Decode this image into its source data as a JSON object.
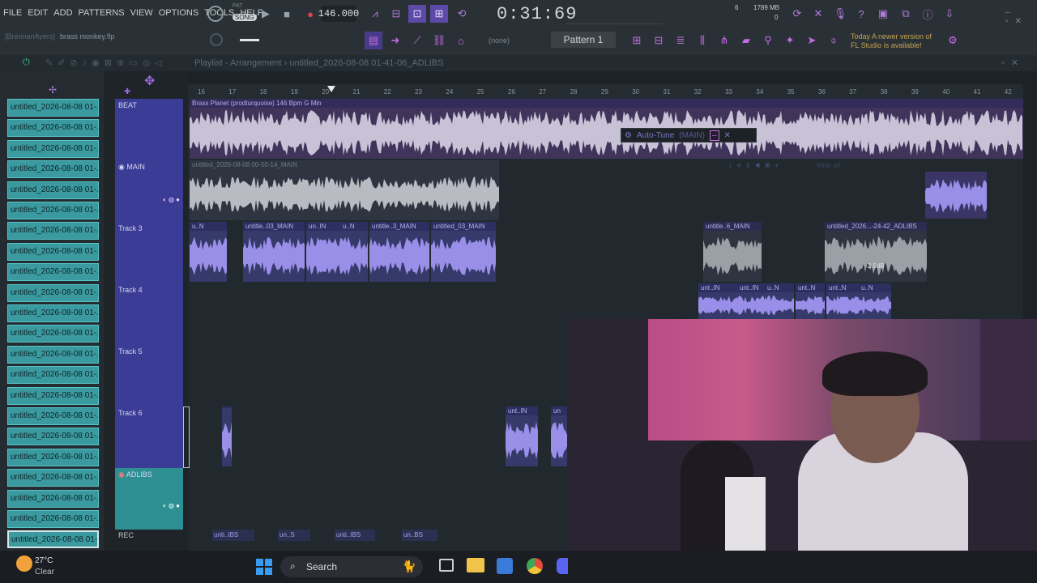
{
  "menu": [
    "FILE",
    "EDIT",
    "ADD",
    "PATTERNS",
    "VIEW",
    "OPTIONS",
    "TOOLS",
    "HELP"
  ],
  "transport": {
    "mode": "SONG",
    "pat_label": "PAT",
    "tempo": "146.000",
    "time": "0:31:69",
    "memory": "1789 MB",
    "cpu": "0",
    "polyphony": "6"
  },
  "project": {
    "hint": "[BrennanAyers]",
    "name": "brass monkey.flp",
    "pattern": "Pattern 1",
    "none": "(none)"
  },
  "news": {
    "line1": "Today  A newer version of",
    "line2": "FL Studio is available!"
  },
  "playlist": {
    "title": "Playlist - Arrangement › untitled_2026-08-08 01-41-06_ADLIBS"
  },
  "pattern_items": [
    "untitled_2026-08-08 01-...",
    "untitled_2026-08-08 01-...",
    "untitled_2026-08-08 01-...",
    "untitled_2026-08-08 01-...",
    "untitled_2026-08-08 01-...",
    "untitled_2026-08-08 01-...",
    "untitled_2026-08-08 01-...",
    "untitled_2026-08-08 01-...",
    "untitled_2026-08-08 01-...",
    "untitled_2026-08-08 01-...",
    "untitled_2026-08-08 01-...",
    "untitled_2026-08-08 01-...",
    "untitled_2026-08-08 01-...",
    "untitled_2026-08-08 01-...",
    "untitled_2026-08-08 01-...",
    "untitled_2026-08-08 01-...",
    "untitled_2026-08-08 01-...",
    "untitled_2026-08-08 01-...",
    "untitled_2026-08-08 01-...",
    "untitled_2026-08-08 01-...",
    "untitled_2026-08-08 01-...",
    "untitled_2026-08-08 01-..."
  ],
  "ruler": [
    "16",
    "17",
    "18",
    "19",
    "20",
    "21",
    "22",
    "23",
    "24",
    "25",
    "26",
    "27",
    "28",
    "29",
    "30",
    "31",
    "32",
    "33",
    "34",
    "35",
    "36",
    "37",
    "38",
    "39",
    "40",
    "41",
    "42"
  ],
  "tracks": [
    "BEAT",
    "MAIN",
    "Track 3",
    "Track 4",
    "Track 5",
    "Track 6",
    "ADLIBS",
    "REC"
  ],
  "clips": {
    "beat": "Brass Planet (prodturquoise) 146 Bpm G Min",
    "main": "untitled_2026-08-08 00-50-14_MAIN",
    "t3": [
      "u..N",
      "untitle..03_MAIN",
      "un..IN",
      "u..N",
      "untitle..3_MAIN",
      "untitled_03_MAIN"
    ],
    "t3b": "untitle..6_MAIN",
    "t3c": "untitled_2026...-24-42_ADLIBS",
    "t3c_gain": "-2.5dB",
    "t4": [
      "unt..IN",
      "unt..IN",
      "u..N",
      "unt..N",
      "unt..N",
      "u..N"
    ],
    "t6": [
      "unt..IN",
      "un"
    ],
    "rec": [
      "unti..IBS",
      "un..S",
      "unti..IBS",
      "un..BS"
    ]
  },
  "plugin": {
    "name": "Auto-Tune",
    "target": "(MAIN)",
    "wide": "Wide aff"
  },
  "weather": {
    "temp": "27°C",
    "cond": "Clear"
  },
  "taskbar": {
    "search": "Search"
  }
}
